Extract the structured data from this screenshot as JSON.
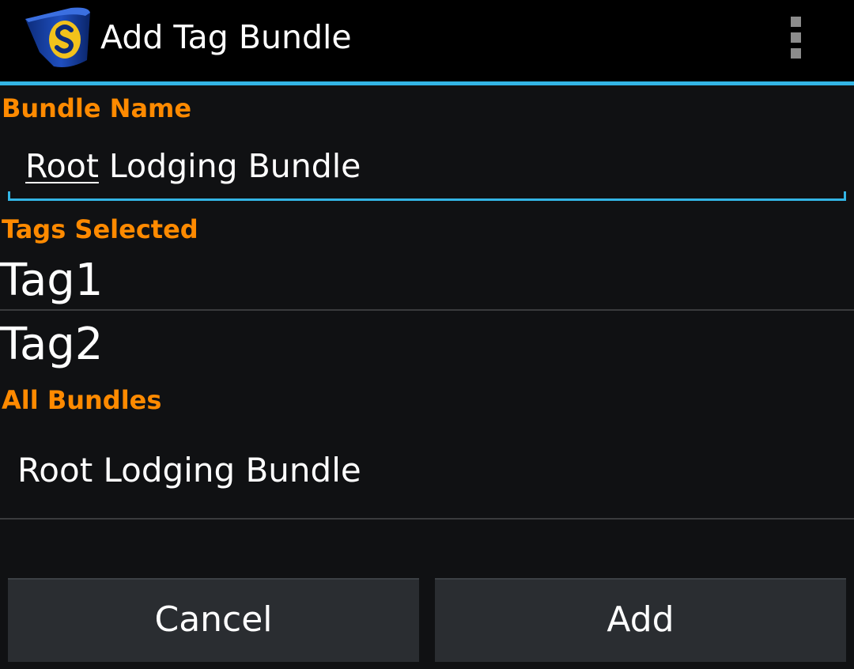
{
  "action_bar": {
    "title": "Add Tag Bundle",
    "app_icon": "app-logo-icon",
    "overflow_icon": "overflow-menu-icon"
  },
  "form": {
    "bundle_name_header": "Bundle Name",
    "bundle_name_value": {
      "composing": "Root",
      "rest": " Lodging Bundle"
    },
    "tags_selected_header": "Tags Selected",
    "tags": [
      "Tag1",
      "Tag2"
    ],
    "all_bundles_header": "All Bundles",
    "bundles": [
      "Root Lodging Bundle"
    ]
  },
  "buttons": {
    "cancel": "Cancel",
    "add": "Add"
  },
  "colors": {
    "accent": "#33b5e5",
    "section_header": "#ff8a00",
    "background": "#101113",
    "button": "#2a2d31"
  }
}
